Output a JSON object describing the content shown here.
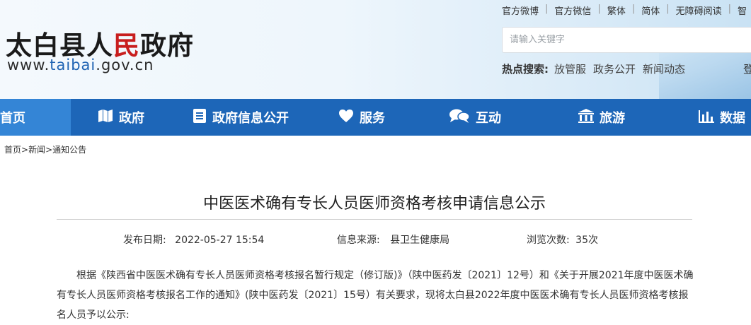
{
  "header": {
    "title_black": "太白县人",
    "title_red": "民",
    "title_black2": "政府",
    "url_prefix": "www.",
    "url_brand": "taibai",
    "url_suffix": ".gov.cn"
  },
  "toplinks": [
    "官方微博",
    "官方微信",
    "繁体",
    "简体",
    "无障碍阅读",
    "智"
  ],
  "search": {
    "placeholder": "请输入关键字"
  },
  "hot": {
    "label": "热点搜索:",
    "items": [
      "放管服",
      "政务公开",
      "新闻动态"
    ],
    "login": "登"
  },
  "nav": [
    {
      "label": "首页",
      "icon": "home"
    },
    {
      "label": "政府",
      "icon": "map-icon"
    },
    {
      "label": "政府信息公开",
      "icon": "list-icon"
    },
    {
      "label": "服务",
      "icon": "heart-icon"
    },
    {
      "label": "互动",
      "icon": "chat-icon"
    },
    {
      "label": "旅游",
      "icon": "temple-icon"
    },
    {
      "label": "数据",
      "icon": "bar-chart-icon"
    }
  ],
  "breadcrumb": {
    "items": [
      "首页",
      "新闻",
      "通知公告"
    ]
  },
  "article": {
    "title": "中医医术确有专长人员医师资格考核申请信息公示",
    "publish_label": "发布日期:",
    "publish_value": "2022-05-27 15:54",
    "source_label": "信息来源:",
    "source_value": "县卫生健康局",
    "views_label": "浏览次数:",
    "views_value": "35次",
    "body": "根据《陕西省中医医术确有专长人员医师资格考核报名暂行规定（修订版)》（陕中医药发〔2021〕12号）和《关于开展2021年度中医医术确有专长人员医师资格考核报名工作的通知》(陕中医药发〔2021〕15号）有关要求，现将太白县2022年度中医医术确有专长人员医师资格考核报名人员予以公示:"
  },
  "colors": {
    "nav_bg": "#1d66b8",
    "nav_active": "#3485d6",
    "title_red": "#c81e1e",
    "url_blue": "#1f63b3"
  }
}
